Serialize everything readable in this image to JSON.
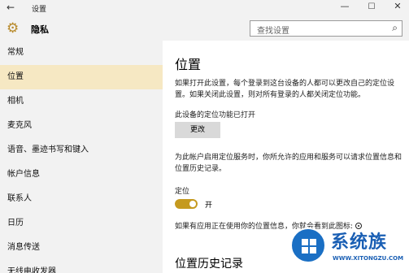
{
  "window": {
    "title": "设置",
    "back_glyph": "←",
    "min_glyph": "—",
    "max_glyph": "☐",
    "close_glyph": "✕"
  },
  "header": {
    "page_title": "隐私",
    "search_placeholder": "查找设置",
    "search_icon_glyph": "⌕",
    "gear_glyph": "⚙"
  },
  "sidebar": {
    "items": [
      {
        "label": "常规"
      },
      {
        "label": "位置"
      },
      {
        "label": "相机"
      },
      {
        "label": "麦克风"
      },
      {
        "label": "语音、墨迹书写和键入"
      },
      {
        "label": "帐户信息"
      },
      {
        "label": "联系人"
      },
      {
        "label": "日历"
      },
      {
        "label": "消息传送"
      },
      {
        "label": "无线电收发器"
      }
    ],
    "active_index": 1
  },
  "content": {
    "heading": "位置",
    "intro": "如果打开此设置，每个登录到这台设备的人都可以更改自己的定位设置。如果关闭此设置，则对所有登录的人都关闭定位功能。",
    "device_status": "此设备的定位功能已打开",
    "change_button": "更改",
    "account_text": "为此帐户启用定位服务时，你所允许的应用和服务可以请求位置信息和位置历史记录。",
    "location_label": "定位",
    "toggle_state": "开",
    "toggle_on": true,
    "usage_notice": "如果有应用正在使用你的位置信息，你就会看到此图标:",
    "history_heading": "位置历史记录"
  },
  "watermark": {
    "brand": "系统族",
    "url": "WWW.XITONGZU.COM"
  },
  "colors": {
    "accent": "#c59a1f",
    "active_nav": "#f6e8c3",
    "sidebar_bg": "#f2f2f2",
    "button_bg": "#d9d9d9",
    "watermark_blue": "#1a5fb4"
  }
}
